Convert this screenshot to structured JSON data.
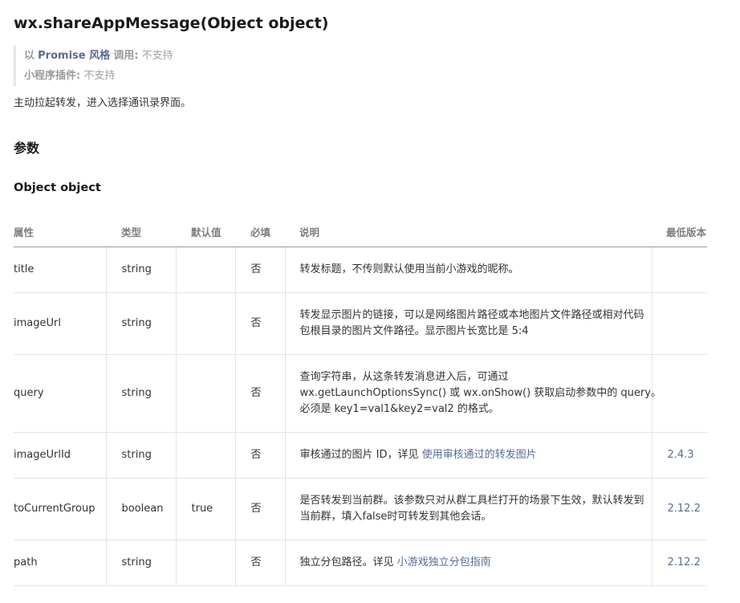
{
  "api": {
    "title": "wx.shareAppMessage(Object object)"
  },
  "notes": {
    "promise_prefix": "以",
    "promise_link": "Promise 风格",
    "promise_key": "调用",
    "promise_value": "不支持",
    "plugin_key": "小程序插件",
    "plugin_value": "不支持"
  },
  "description": "主动拉起转发，进入选择通讯录界面。",
  "sections": {
    "params_heading": "参数",
    "object_heading": "Object object"
  },
  "table": {
    "headers": {
      "name": "属性",
      "type": "类型",
      "default": "默认值",
      "required": "必填",
      "desc": "说明",
      "version": "最低版本"
    },
    "rows": [
      {
        "name": "title",
        "type": "string",
        "default": "",
        "required": "否",
        "desc_lines": [
          "转发标题，不传则默认使用当前小游戏的昵称。"
        ],
        "desc_link": "",
        "version": ""
      },
      {
        "name": "imageUrl",
        "type": "string",
        "default": "",
        "required": "否",
        "desc_lines": [
          "转发显示图片的链接，可以是网络图片路径或本地图片文件路径或相对代码",
          "包根目录的图片文件路径。显示图片长宽比是 5:4"
        ],
        "desc_link": "",
        "version": ""
      },
      {
        "name": "query",
        "type": "string",
        "default": "",
        "required": "否",
        "desc_lines": [
          "查询字符串，从这条转发消息进入后，可通过",
          "wx.getLaunchOptionsSync() 或 wx.onShow() 获取启动参数中的 query。",
          "必须是 key1=val1&key2=val2 的格式。"
        ],
        "desc_link": "",
        "version": ""
      },
      {
        "name": "imageUrlId",
        "type": "string",
        "default": "",
        "required": "否",
        "desc_lines": [
          "审核通过的图片 ID，详见 "
        ],
        "desc_link": "使用审核通过的转发图片",
        "version": "2.4.3"
      },
      {
        "name": "toCurrentGroup",
        "type": "boolean",
        "default": "true",
        "required": "否",
        "desc_lines": [
          "是否转发到当前群。该参数只对从群工具栏打开的场景下生效，默认转发到",
          "当前群，填入false时可转发到其他会话。"
        ],
        "desc_link": "",
        "version": "2.12.2"
      },
      {
        "name": "path",
        "type": "string",
        "default": "",
        "required": "否",
        "desc_lines": [
          "独立分包路径。详见 "
        ],
        "desc_link": "小游戏独立分包指南",
        "version": "2.12.2"
      }
    ]
  },
  "colors": {
    "link": "#576b95",
    "muted": "#a0a0a0",
    "border": "#e3e3e3"
  }
}
